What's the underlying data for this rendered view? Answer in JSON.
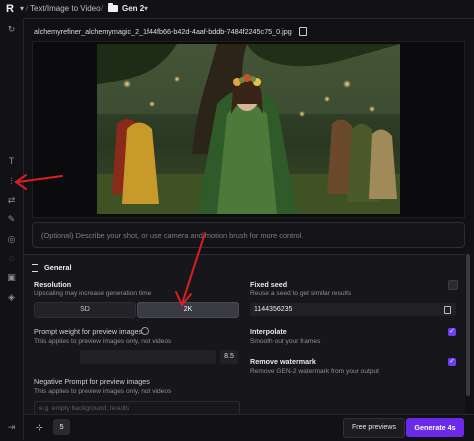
{
  "topbar": {
    "logo": "R",
    "breadcrumb_tool": "Text/Image to Video",
    "breadcrumb_folder": "Gen 2"
  },
  "asset": {
    "filename": "alchemyrefiner_alchemymagic_2_1f44fb66-b42d-4aaf-bddb-7484f2245c75_0.jpg"
  },
  "prompt": {
    "placeholder": "(Optional) Describe your shot, or use camera and motion brush for more control."
  },
  "settings": {
    "section_title": "General",
    "resolution": {
      "label": "Resolution",
      "hint": "Upscaling may increase generation time",
      "options": [
        "SD",
        "2K"
      ],
      "selected": "2K"
    },
    "prompt_weight": {
      "label": "Prompt weight for preview images",
      "hint": "This applies to preview images only, not videos",
      "value": "8.5"
    },
    "negative_prompt": {
      "label": "Negative Prompt for preview images",
      "hint": "This applies to preview images only, not videos",
      "placeholder": "e.g. empty background, results"
    },
    "fixed_seed": {
      "label": "Fixed seed",
      "hint": "Reuse a seed to get similar results",
      "value": "1144356235",
      "checked": false
    },
    "interpolate": {
      "label": "Interpolate",
      "hint": "Smooth out your frames",
      "checked": true
    },
    "remove_watermark": {
      "label": "Remove watermark",
      "hint": "Remove GEN-2 watermark from your output",
      "checked": true
    }
  },
  "bottombar": {
    "count": "5",
    "free_previews_label": "Free previews",
    "generate_label": "Generate 4s"
  },
  "colors": {
    "accent": "#6a2ae8",
    "annotation_arrow": "#d81f1f"
  }
}
